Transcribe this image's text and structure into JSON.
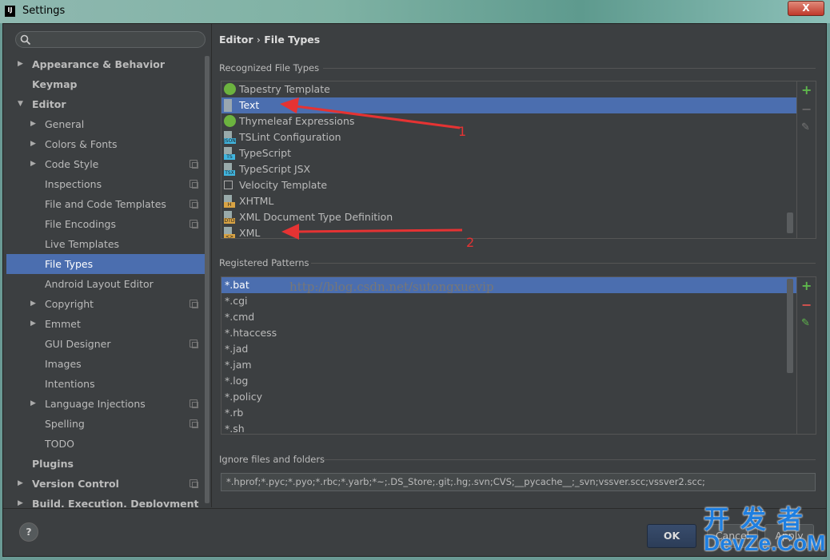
{
  "window": {
    "title": "Settings",
    "close_label": "X",
    "logo": "IJ"
  },
  "search": {
    "placeholder": "",
    "value": ""
  },
  "sidebar": {
    "items": [
      {
        "label": "Appearance & Behavior",
        "level": 0,
        "expander": "collapsed",
        "bold": true
      },
      {
        "label": "Keymap",
        "level": 0,
        "expander": "none",
        "bold": true
      },
      {
        "label": "Editor",
        "level": 0,
        "expander": "expanded",
        "bold": true
      },
      {
        "label": "General",
        "level": 1,
        "expander": "collapsed"
      },
      {
        "label": "Colors & Fonts",
        "level": 1,
        "expander": "collapsed"
      },
      {
        "label": "Code Style",
        "level": 1,
        "expander": "collapsed",
        "project": true
      },
      {
        "label": "Inspections",
        "level": 1,
        "expander": "none",
        "project": true
      },
      {
        "label": "File and Code Templates",
        "level": 1,
        "expander": "none",
        "project": true
      },
      {
        "label": "File Encodings",
        "level": 1,
        "expander": "none",
        "project": true
      },
      {
        "label": "Live Templates",
        "level": 1,
        "expander": "none"
      },
      {
        "label": "File Types",
        "level": 1,
        "expander": "none",
        "selected": true
      },
      {
        "label": "Android Layout Editor",
        "level": 1,
        "expander": "none"
      },
      {
        "label": "Copyright",
        "level": 1,
        "expander": "collapsed",
        "project": true
      },
      {
        "label": "Emmet",
        "level": 1,
        "expander": "collapsed"
      },
      {
        "label": "GUI Designer",
        "level": 1,
        "expander": "none",
        "project": true
      },
      {
        "label": "Images",
        "level": 1,
        "expander": "none"
      },
      {
        "label": "Intentions",
        "level": 1,
        "expander": "none"
      },
      {
        "label": "Language Injections",
        "level": 1,
        "expander": "collapsed",
        "project": true
      },
      {
        "label": "Spelling",
        "level": 1,
        "expander": "none",
        "project": true
      },
      {
        "label": "TODO",
        "level": 1,
        "expander": "none"
      },
      {
        "label": "Plugins",
        "level": 0,
        "expander": "none",
        "bold": true
      },
      {
        "label": "Version Control",
        "level": 0,
        "expander": "collapsed",
        "bold": true,
        "project": true
      },
      {
        "label": "Build, Execution, Deployment",
        "level": 0,
        "expander": "collapsed",
        "bold": true
      }
    ]
  },
  "breadcrumb": {
    "parent": "Editor",
    "sep": "›",
    "current": "File Types"
  },
  "recognized": {
    "label": "Recognized File Types",
    "items": [
      {
        "label": "Tapestry Template",
        "icon": "tapestry-icon",
        "color": "#6cb33f"
      },
      {
        "label": "Text",
        "icon": "text-file-icon",
        "color": "#9aa7b0",
        "selected": true
      },
      {
        "label": "Thymeleaf Expressions",
        "icon": "thymeleaf-leaf-icon",
        "color": "#6cb33f"
      },
      {
        "label": "TSLint Configuration",
        "icon": "json-file-icon",
        "color": "#40b6e0",
        "tag": "JSON"
      },
      {
        "label": "TypeScript",
        "icon": "typescript-file-icon",
        "color": "#40b6e0",
        "tag": "TS"
      },
      {
        "label": "TypeScript JSX",
        "icon": "tsx-file-icon",
        "color": "#40b6e0",
        "tag": "TSX"
      },
      {
        "label": "Velocity Template",
        "icon": "velocity-icon",
        "color": "#aaaaaa"
      },
      {
        "label": "XHTML",
        "icon": "xhtml-file-icon",
        "color": "#d9a343",
        "tag": "H"
      },
      {
        "label": "XML Document Type Definition",
        "icon": "dtd-file-icon",
        "color": "#d9a343",
        "tag": "DTD"
      },
      {
        "label": "XML",
        "icon": "xml-file-icon",
        "color": "#d9a343",
        "tag": "<>"
      }
    ],
    "add": "+",
    "remove": "−",
    "edit": "✎"
  },
  "patterns": {
    "label": "Registered Patterns",
    "items": [
      "*.bat",
      "*.cgi",
      "*.cmd",
      "*.htaccess",
      "*.jad",
      "*.jam",
      "*.log",
      "*.policy",
      "*.rb",
      "*.sh"
    ],
    "selected": 0,
    "add": "+",
    "remove": "−",
    "edit": "✎"
  },
  "ignore": {
    "label": "Ignore files and folders",
    "value": "*.hprof;*.pyc;*.pyo;*.rbc;*.yarb;*~;.DS_Store;.git;.hg;.svn;CVS;__pycache__;_svn;vssver.scc;vssver2.scc;"
  },
  "buttons": {
    "help": "?",
    "ok": "OK",
    "cancel": "Cancel",
    "apply": "Apply"
  },
  "annotations": {
    "arrow1": "1",
    "arrow2": "2",
    "arrow_color": "#e53333"
  },
  "watermark": {
    "url": "http://blog.csdn.net/sutongxuevip",
    "site_cn": "开发者",
    "site": "DevZe.CoM"
  },
  "colors": {
    "background": "#3c3f41",
    "selection": "#4b6eaf"
  }
}
